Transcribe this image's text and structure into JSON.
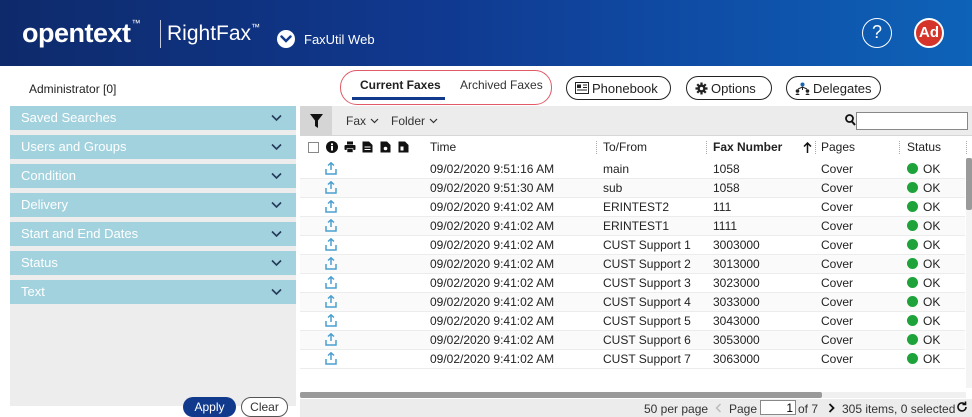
{
  "header": {
    "logo": "opentext",
    "logo_tm": "™",
    "product": "RightFax",
    "product_tm": "™",
    "app_name": "FaxUtil Web",
    "help_label": "?",
    "avatar_initials": "Ad",
    "avatar_color": "#d4342a"
  },
  "user": {
    "label": "Administrator [0]"
  },
  "tabs": [
    {
      "label": "Current Faxes",
      "active": true
    },
    {
      "label": "Archived Faxes",
      "active": false
    }
  ],
  "actions": {
    "phonebook": "Phonebook",
    "options": "Options",
    "delegates": "Delegates"
  },
  "filters": [
    {
      "label": "Saved Searches"
    },
    {
      "label": "Users and Groups"
    },
    {
      "label": "Condition"
    },
    {
      "label": "Delivery"
    },
    {
      "label": "Start and End Dates"
    },
    {
      "label": "Status"
    },
    {
      "label": "Text"
    }
  ],
  "filter_buttons": {
    "apply": "Apply",
    "clear": "Clear"
  },
  "toolbar": {
    "fax": "Fax",
    "folder": "Folder",
    "search_value": ""
  },
  "columns": {
    "time": "Time",
    "to_from": "To/From",
    "fax_number": "Fax Number",
    "pages": "Pages",
    "status": "Status"
  },
  "rows": [
    {
      "time": "09/02/2020 9:51:16 AM",
      "to_from": "main",
      "fax_number": "1058",
      "pages": "Cover",
      "status": "OK"
    },
    {
      "time": "09/02/2020 9:51:30 AM",
      "to_from": "sub",
      "fax_number": "1058",
      "pages": "Cover",
      "status": "OK"
    },
    {
      "time": "09/02/2020 9:41:02 AM",
      "to_from": "ERINTEST2",
      "fax_number": "111",
      "pages": "Cover",
      "status": "OK"
    },
    {
      "time": "09/02/2020 9:41:02 AM",
      "to_from": "ERINTEST1",
      "fax_number": "1111",
      "pages": "Cover",
      "status": "OK"
    },
    {
      "time": "09/02/2020 9:41:02 AM",
      "to_from": "CUST Support 1",
      "fax_number": "3003000",
      "pages": "Cover",
      "status": "OK"
    },
    {
      "time": "09/02/2020 9:41:02 AM",
      "to_from": "CUST Support 2",
      "fax_number": "3013000",
      "pages": "Cover",
      "status": "OK"
    },
    {
      "time": "09/02/2020 9:41:02 AM",
      "to_from": "CUST Support 3",
      "fax_number": "3023000",
      "pages": "Cover",
      "status": "OK"
    },
    {
      "time": "09/02/2020 9:41:02 AM",
      "to_from": "CUST Support 4",
      "fax_number": "3033000",
      "pages": "Cover",
      "status": "OK"
    },
    {
      "time": "09/02/2020 9:41:02 AM",
      "to_from": "CUST Support 5",
      "fax_number": "3043000",
      "pages": "Cover",
      "status": "OK"
    },
    {
      "time": "09/02/2020 9:41:02 AM",
      "to_from": "CUST Support 6",
      "fax_number": "3053000",
      "pages": "Cover",
      "status": "OK"
    },
    {
      "time": "09/02/2020 9:41:02 AM",
      "to_from": "CUST Support 7",
      "fax_number": "3063000",
      "pages": "Cover",
      "status": "OK"
    }
  ],
  "footer": {
    "per_page": "50 per page",
    "page_label": "Page",
    "page_value": "1",
    "of_total": "of 7",
    "summary": "305 items, 0 selected"
  },
  "colors": {
    "filter_row": "#a2d2de",
    "accent": "#123a8c",
    "status_ok": "#1ea33a",
    "upload_icon": "#4a9fd0"
  },
  "icons": {
    "row_icon": "upload-arrow-icon",
    "sort": "arrow-up-icon",
    "refresh": "refresh-icon"
  }
}
